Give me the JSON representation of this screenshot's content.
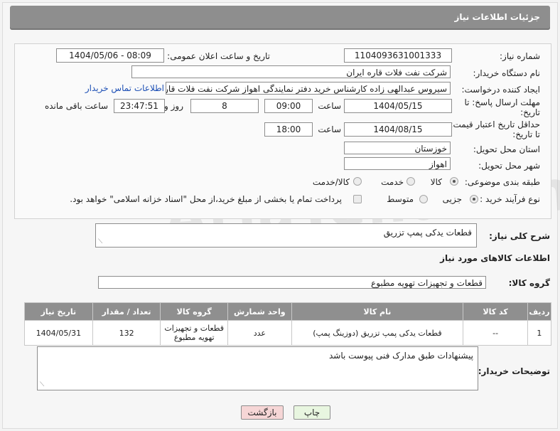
{
  "header": {
    "title": "جزئیات اطلاعات نیاز"
  },
  "fields": {
    "need_number_label": "شماره نیاز:",
    "need_number": "1104093631001333",
    "announce_label": "تاریخ و ساعت اعلان عمومی:",
    "announce_value": "1404/05/06 - 08:09",
    "buyer_org_label": "نام دستگاه خریدار:",
    "buyer_org": "شرکت نفت فلات قاره ایران",
    "requester_label": "ایجاد کننده درخواست:",
    "requester": "سیروس عبدالهی زاده کارشناس خرید دفتر نمایندگی اهواز شرکت نفت فلات قار",
    "contact_link": "اطلاعات تماس خریدار",
    "deadline_label_1": "مهلت ارسال پاسخ: تا",
    "deadline_label_2": "تاریخ:",
    "deadline_date": "1404/05/15",
    "time_word": "ساعت",
    "deadline_time": "09:00",
    "days": "8",
    "days_word": "روز و",
    "remaining": "23:47:51",
    "remaining_word": "ساعت باقی مانده",
    "price_label_1": "حداقل تاریخ اعتبار قیمت:",
    "price_label_2": "تا تاریخ:",
    "price_date": "1404/08/15",
    "price_time": "18:00",
    "province_label": "استان محل تحویل:",
    "province": "خوزستان",
    "city_label": "شهر محل تحویل:",
    "city": "اهواز",
    "category_label": "طبقه بندی موضوعی:",
    "cat_goods": "کالا",
    "cat_service": "خدمت",
    "cat_both": "کالا/خدمت",
    "purchase_label": "نوع فرآیند خرید :",
    "purchase_partial": "جزیی",
    "purchase_medium": "متوسط",
    "payment_note": "پرداخت تمام یا بخشی از مبلغ خرید،از محل \"اسناد خزانه اسلامی\" خواهد بود."
  },
  "description": {
    "label": "شرح کلی نیاز:",
    "value": "قطعات یدکی پمپ تزریق"
  },
  "goods_info": {
    "title": "اطلاعات کالاهای مورد نیاز",
    "group_label": "گروه کالا:",
    "group_value": "قطعات و تجهیزات تهویه مطبوع"
  },
  "table": {
    "headers": [
      "ردیف",
      "کد کالا",
      "نام کالا",
      "واحد شمارش",
      "گروه کالا",
      "تعداد / مقدار",
      "تاریخ نیاز"
    ],
    "rows": [
      [
        "1",
        "--",
        "قطعات یدکی پمپ تزریق (دوزینگ پمپ)",
        "عدد",
        "قطعات و تجهیزات تهویه مطبوع",
        "132",
        "1404/05/31"
      ]
    ]
  },
  "buyer_notes": {
    "label": "توضیحات خریدار:",
    "value": "پیشنهادات طبق مدارک فنی پیوست باشد"
  },
  "buttons": {
    "print": "چاپ",
    "back": "بازگشت"
  },
  "watermark": "AriaTender.net",
  "colors": {
    "titlebar": "#8e8e8e",
    "link": "#1d4fb5",
    "back_button": "#f6d6d6",
    "print_button": "#e8f6e0"
  }
}
